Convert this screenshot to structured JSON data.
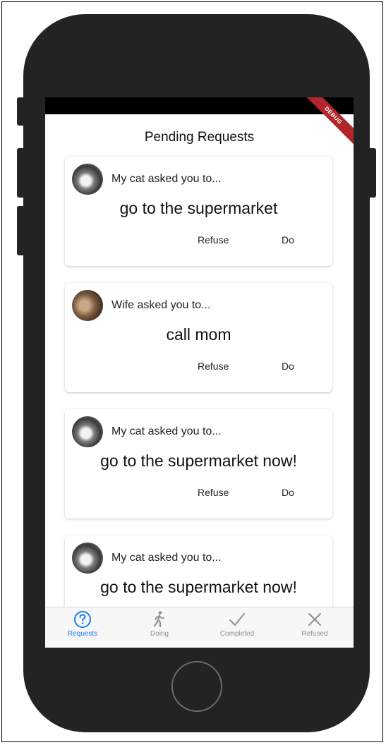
{
  "app": {
    "debug_label": "DEBUG",
    "title": "Pending Requests"
  },
  "requests": [
    {
      "asker": "My cat asked you to...",
      "task": "go to the supermarket",
      "refuse": "Refuse",
      "do": "Do",
      "avatar": "cat-avatar"
    },
    {
      "asker": "Wife asked you to...",
      "task": "call mom",
      "refuse": "Refuse",
      "do": "Do",
      "avatar": "wife-avatar"
    },
    {
      "asker": "My cat asked you to...",
      "task": "go to the supermarket now!",
      "refuse": "Refuse",
      "do": "Do",
      "avatar": "cat-avatar"
    },
    {
      "asker": "My cat asked you to...",
      "task": "go to the supermarket now!",
      "avatar": "cat-avatar"
    }
  ],
  "tabs": [
    {
      "label": "Requests",
      "icon": "question-circle-icon",
      "active": true
    },
    {
      "label": "Doing",
      "icon": "walking-person-icon",
      "active": false
    },
    {
      "label": "Completed",
      "icon": "checkmark-icon",
      "active": false
    },
    {
      "label": "Refused",
      "icon": "x-icon",
      "active": false
    }
  ],
  "colors": {
    "accent": "#1a7df2",
    "inactive": "#8e8e93",
    "debug_banner": "#b0262b",
    "phone_body": "#232323"
  }
}
